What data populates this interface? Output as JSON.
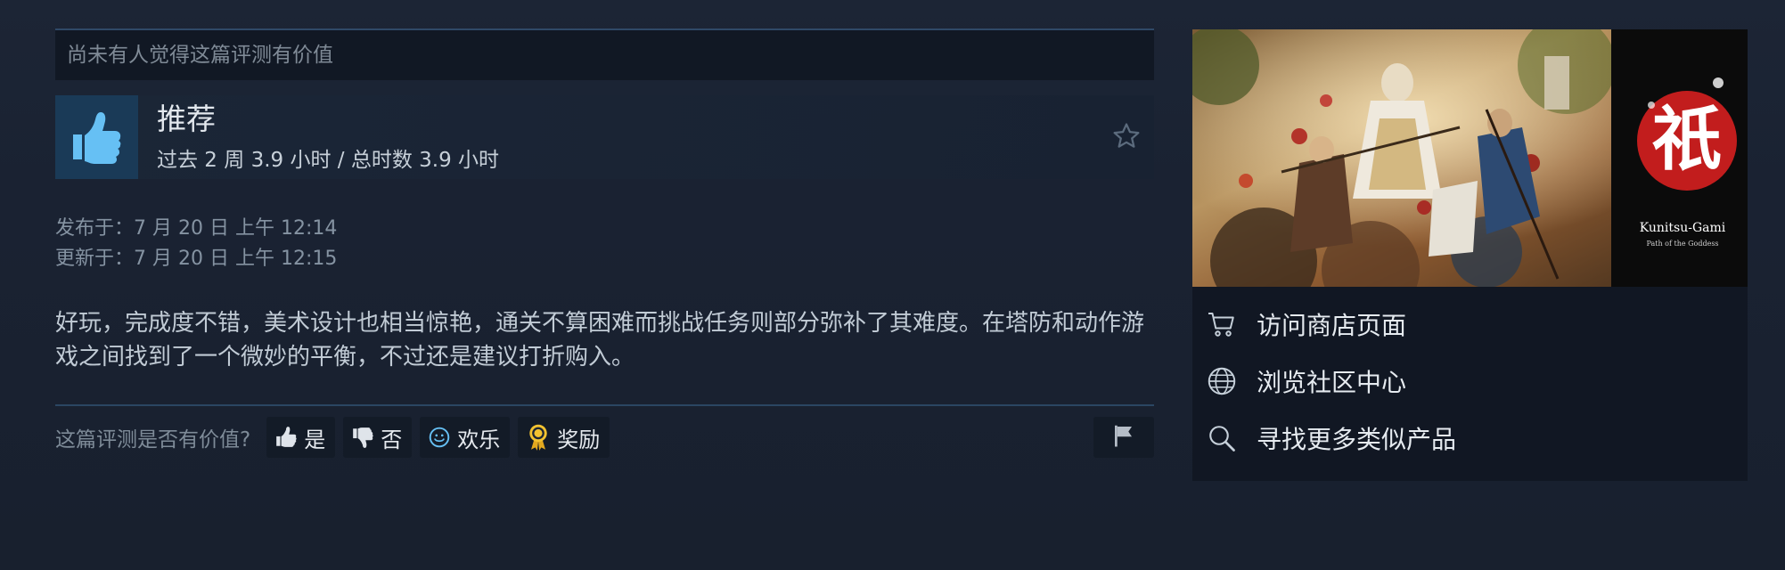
{
  "review": {
    "helpful_count_text": "尚未有人觉得这篇评测有价值",
    "verdict": "推荐",
    "hours": "过去 2 周 3.9 小时 / 总时数 3.9 小时",
    "posted": "发布于：7 月 20 日 上午 12:14",
    "updated": "更新于：7 月 20 日 上午 12:15",
    "body": "好玩，完成度不错，美术设计也相当惊艳，通关不算困难而挑战任务则部分弥补了其难度。在塔防和动作游戏之间找到了一个微妙的平衡，不过还是建议打折购入。"
  },
  "vote": {
    "prompt": "这篇评测是否有价值?",
    "yes": "是",
    "no": "否",
    "funny": "欢乐",
    "award": "奖励"
  },
  "game": {
    "logo_glyph": "祇",
    "logo_title": "Kunitsu-Gami",
    "logo_subtitle": "Path of the Goddess"
  },
  "links": [
    {
      "label": "访问商店页面",
      "icon": "cart-icon"
    },
    {
      "label": "浏览社区中心",
      "icon": "globe-icon"
    },
    {
      "label": "寻找更多类似产品",
      "icon": "magnifier-icon"
    }
  ],
  "colors": {
    "accent_blue": "#66c0f4",
    "thumb_bg": "#1a3a57",
    "award_gold": "#f2c230"
  }
}
